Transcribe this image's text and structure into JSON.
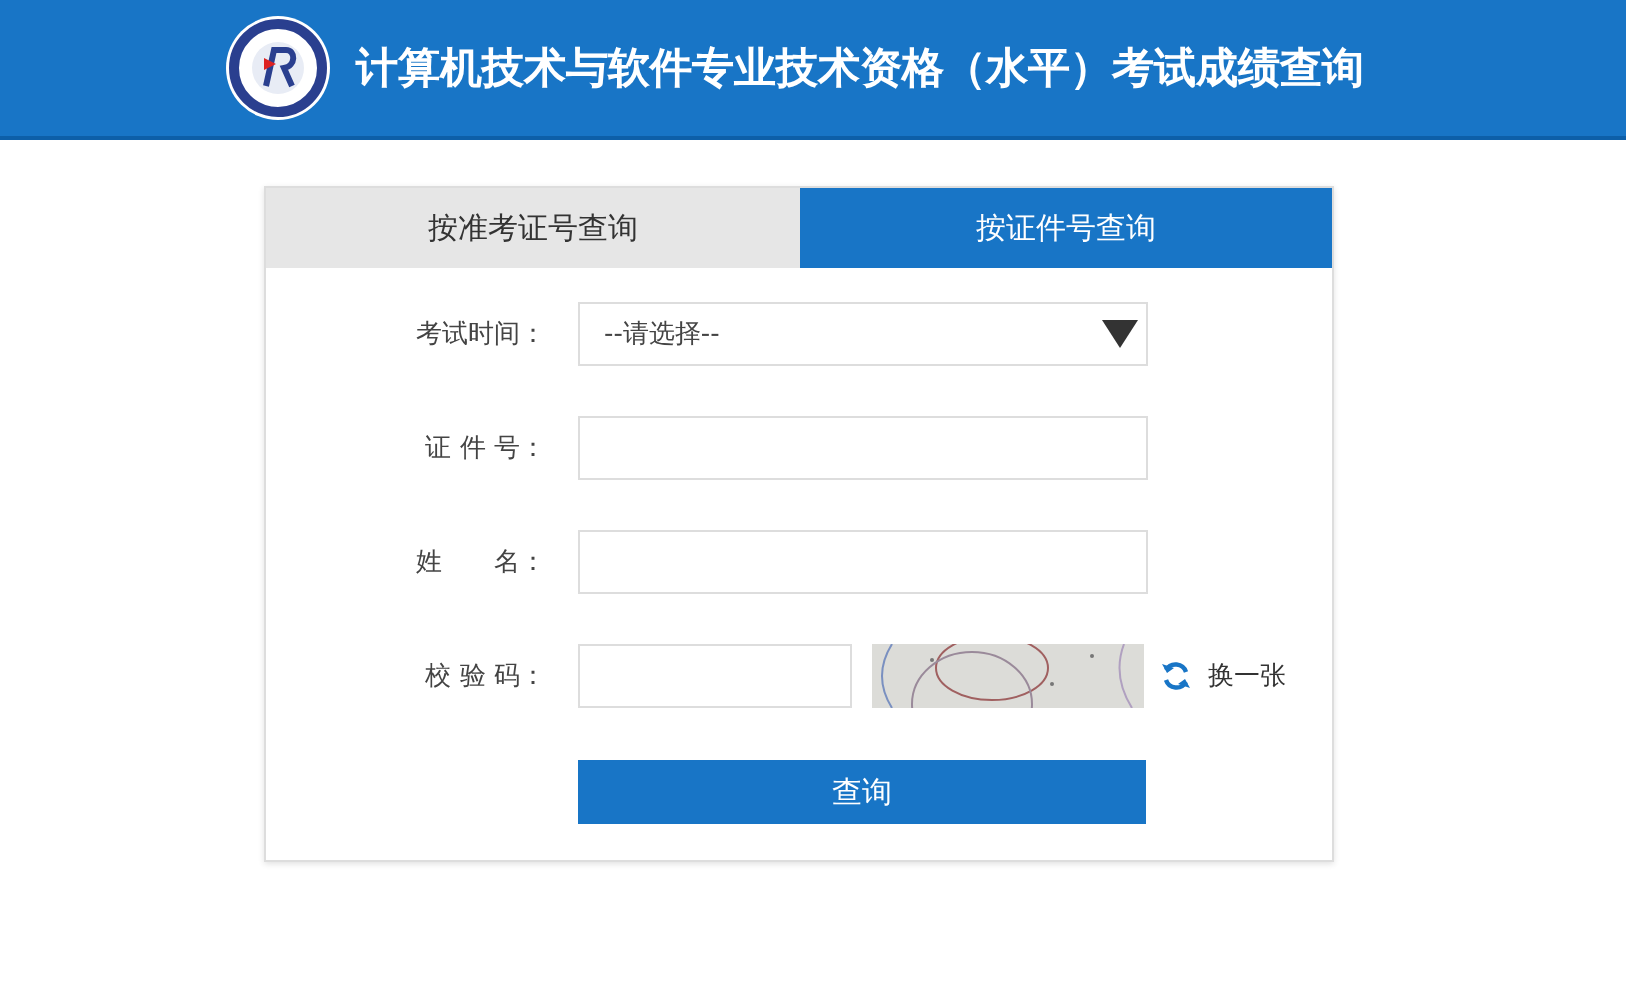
{
  "header": {
    "title": "计算机技术与软件专业技术资格（水平）考试成绩查询"
  },
  "tabs": [
    {
      "label": "按准考证号查询",
      "selected": false
    },
    {
      "label": "按证件号查询",
      "selected": true
    }
  ],
  "form": {
    "fields": [
      {
        "kind": "select",
        "label": "考试时间：",
        "value": "--请选择--"
      },
      {
        "kind": "text",
        "label": "证 件 号："
      },
      {
        "kind": "text",
        "label": "姓　　名："
      },
      {
        "kind": "captcha",
        "label": "校 验 码：",
        "refresh": "换一张"
      }
    ],
    "submit": "查询"
  }
}
